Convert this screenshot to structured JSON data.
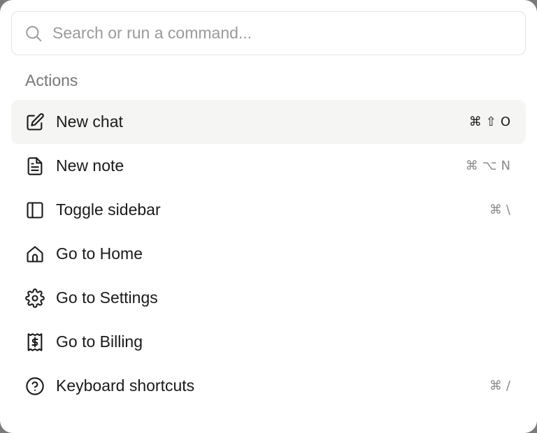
{
  "search": {
    "placeholder": "Search or run a command...",
    "value": ""
  },
  "section": {
    "label": "Actions"
  },
  "items": [
    {
      "label": "New chat",
      "icon": "edit-icon",
      "shortcut": [
        "⌘",
        "⇧",
        "O"
      ],
      "selected": true
    },
    {
      "label": "New note",
      "icon": "note-icon",
      "shortcut": [
        "⌘",
        "⌥",
        "N"
      ],
      "selected": false
    },
    {
      "label": "Toggle sidebar",
      "icon": "sidebar-icon",
      "shortcut": [
        "⌘",
        "\\"
      ],
      "selected": false
    },
    {
      "label": "Go to Home",
      "icon": "home-icon",
      "shortcut": [],
      "selected": false
    },
    {
      "label": "Go to Settings",
      "icon": "gear-icon",
      "shortcut": [],
      "selected": false
    },
    {
      "label": "Go to Billing",
      "icon": "receipt-icon",
      "shortcut": [],
      "selected": false
    },
    {
      "label": "Keyboard shortcuts",
      "icon": "help-circle-icon",
      "shortcut": [
        "⌘",
        "/"
      ],
      "selected": false
    }
  ],
  "colors": {
    "selected_bg": "#f5f5f3",
    "text": "#1a1a1a",
    "muted": "#8a8a8a",
    "border": "#e3e3e1"
  }
}
